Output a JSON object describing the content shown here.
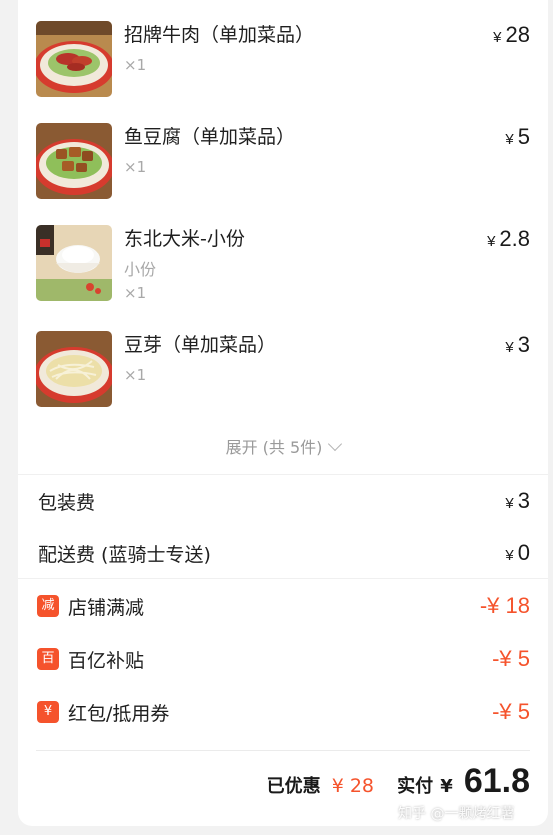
{
  "items": [
    {
      "name": "招牌牛肉（单加菜品）",
      "spec": "",
      "qty": "×1",
      "currency": "¥",
      "price": "28",
      "image_icon": "beef-dish-photo"
    },
    {
      "name": "鱼豆腐（单加菜品）",
      "spec": "",
      "qty": "×1",
      "currency": "¥",
      "price": "5",
      "image_icon": "fish-tofu-dish-photo"
    },
    {
      "name": "东北大米-小份",
      "spec": "小份",
      "qty": "×1",
      "currency": "¥",
      "price": "2.8",
      "image_icon": "rice-bowl-photo"
    },
    {
      "name": "豆芽（单加菜品）",
      "spec": "",
      "qty": "×1",
      "currency": "¥",
      "price": "3",
      "image_icon": "bean-sprouts-dish-photo"
    }
  ],
  "expand_label": "展开 (共 5件)",
  "fees": [
    {
      "label": "包装费",
      "currency": "¥",
      "value": "3"
    },
    {
      "label": "配送费 (蓝骑士专送)",
      "currency": "¥",
      "value": "0"
    }
  ],
  "discounts": [
    {
      "badge": "减",
      "label": "店铺满减",
      "amount": "-¥ 18"
    },
    {
      "badge": "百",
      "label": "百亿补贴",
      "amount": "-¥ 5"
    },
    {
      "badge": "¥",
      "label": "红包/抵用券",
      "amount": "-¥ 5"
    }
  ],
  "summary": {
    "saved_label": "已优惠",
    "saved_value": "¥ 28",
    "paid_label": "实付",
    "paid_currency": "¥",
    "paid_value": "61.8"
  },
  "watermark": "知乎 @一颗烤红薯",
  "colors": {
    "accent": "#f5532c",
    "text": "#1f1f1f",
    "muted": "#a8a8a8",
    "background": "#f2f2f2"
  }
}
